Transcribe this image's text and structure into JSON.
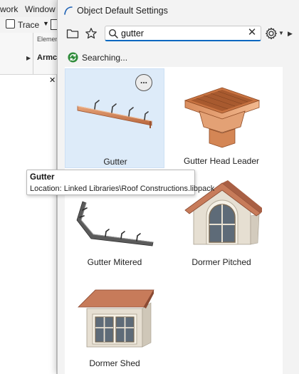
{
  "background_app": {
    "menu": [
      "work",
      "Window"
    ],
    "trace_label": "Trace",
    "panel_label": "Elemen",
    "panel_value": "Armc"
  },
  "window": {
    "title": "Object Default Settings"
  },
  "search": {
    "value": "gutter"
  },
  "status": {
    "text": "Searching..."
  },
  "results": [
    {
      "label": "Gutter",
      "icon": "gutter-image"
    },
    {
      "label": "Gutter Head Leader",
      "icon": "gutter-head-leader-image"
    },
    {
      "label": "Gutter Mitered",
      "icon": "gutter-mitered-image"
    },
    {
      "label": "Dormer Pitched",
      "icon": "dormer-pitched-image"
    },
    {
      "label": "Dormer Shed",
      "icon": "dormer-shed-image"
    }
  ],
  "more_button": "...",
  "tooltip": {
    "title": "Gutter",
    "location": "Location: Linked Libraries\\Roof Constructions.libpack"
  },
  "colors": {
    "accent": "#0067c0",
    "selected_tile": "#ddebf9",
    "status_icon": "#2e8b3a"
  }
}
